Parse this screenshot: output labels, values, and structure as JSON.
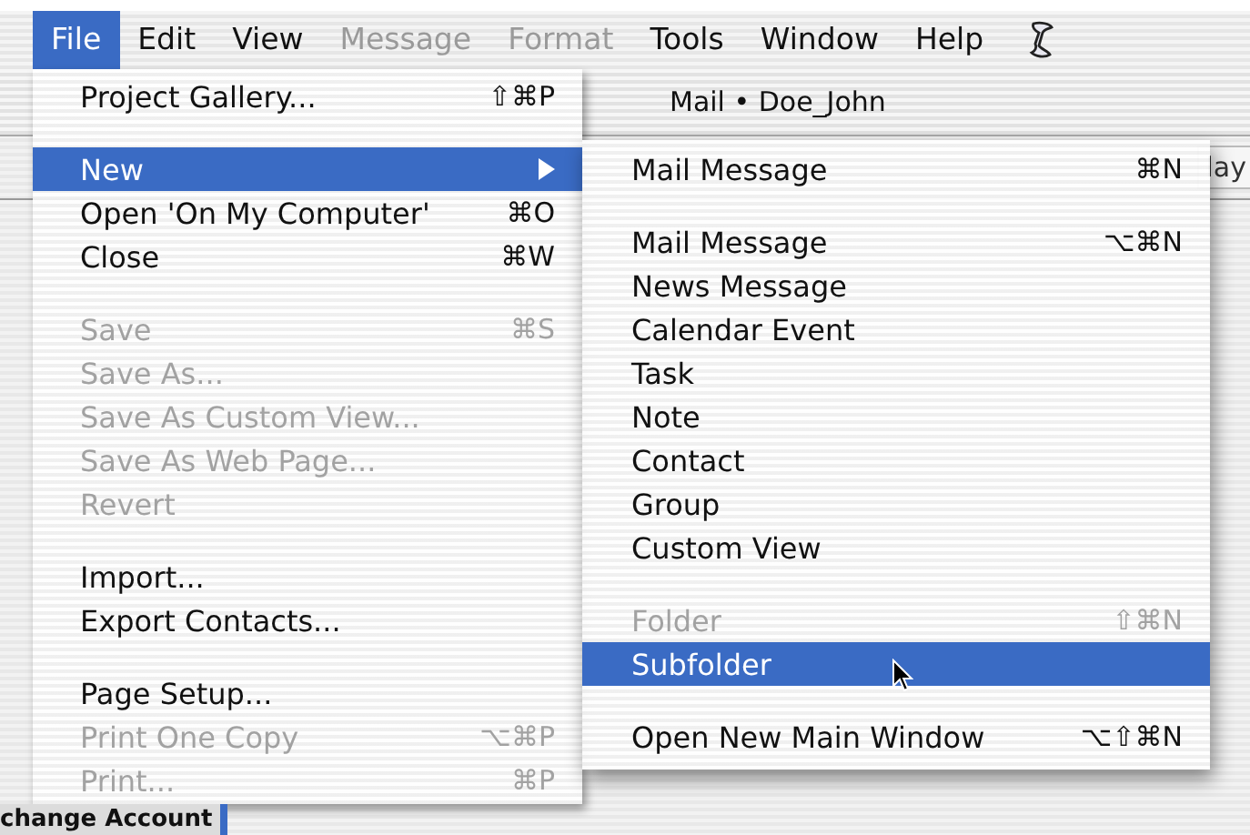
{
  "menubar": {
    "items": [
      {
        "label": "File",
        "selected": true,
        "disabled": false
      },
      {
        "label": "Edit",
        "selected": false,
        "disabled": false
      },
      {
        "label": "View",
        "selected": false,
        "disabled": false
      },
      {
        "label": "Message",
        "selected": false,
        "disabled": true
      },
      {
        "label": "Format",
        "selected": false,
        "disabled": true
      },
      {
        "label": "Tools",
        "selected": false,
        "disabled": false
      },
      {
        "label": "Window",
        "selected": false,
        "disabled": false
      },
      {
        "label": "Help",
        "selected": false,
        "disabled": false
      }
    ]
  },
  "background_window": {
    "title": "Mail • Doe_John",
    "toolbar_button": "lay",
    "sidebar_account": "change Account"
  },
  "file_menu": {
    "items": [
      {
        "kind": "item",
        "label": "Project Gallery...",
        "shortcut": "⇧⌘P",
        "disabled": false,
        "selected": false
      },
      {
        "kind": "separator"
      },
      {
        "kind": "submenu",
        "label": "New",
        "disabled": false,
        "selected": true
      },
      {
        "kind": "item",
        "label": "Open 'On My Computer'",
        "shortcut": "⌘O",
        "disabled": false,
        "selected": false
      },
      {
        "kind": "item",
        "label": "Close",
        "shortcut": "⌘W",
        "disabled": false,
        "selected": false
      },
      {
        "kind": "separator"
      },
      {
        "kind": "item",
        "label": "Save",
        "shortcut": "⌘S",
        "disabled": true,
        "selected": false
      },
      {
        "kind": "item",
        "label": "Save As...",
        "disabled": true,
        "selected": false
      },
      {
        "kind": "item",
        "label": "Save As Custom View...",
        "disabled": true,
        "selected": false
      },
      {
        "kind": "item",
        "label": "Save As Web Page...",
        "disabled": true,
        "selected": false
      },
      {
        "kind": "item",
        "label": "Revert",
        "disabled": true,
        "selected": false
      },
      {
        "kind": "separator"
      },
      {
        "kind": "item",
        "label": "Import...",
        "disabled": false,
        "selected": false
      },
      {
        "kind": "item",
        "label": "Export Contacts...",
        "disabled": false,
        "selected": false
      },
      {
        "kind": "separator"
      },
      {
        "kind": "item",
        "label": "Page Setup...",
        "disabled": false,
        "selected": false
      },
      {
        "kind": "item",
        "label": "Print One Copy",
        "shortcut": "⌥⌘P",
        "disabled": true,
        "selected": false
      },
      {
        "kind": "item",
        "label": "Print...",
        "shortcut": "⌘P",
        "disabled": true,
        "selected": false
      }
    ]
  },
  "new_submenu": {
    "items": [
      {
        "kind": "item",
        "label": "Mail Message",
        "shortcut": "⌘N",
        "disabled": false,
        "selected": false
      },
      {
        "kind": "separator"
      },
      {
        "kind": "item",
        "label": "Mail Message",
        "shortcut": "⌥⌘N",
        "disabled": false,
        "selected": false
      },
      {
        "kind": "item",
        "label": "News Message",
        "disabled": false,
        "selected": false
      },
      {
        "kind": "item",
        "label": "Calendar Event",
        "disabled": false,
        "selected": false
      },
      {
        "kind": "item",
        "label": "Task",
        "disabled": false,
        "selected": false
      },
      {
        "kind": "item",
        "label": "Note",
        "disabled": false,
        "selected": false
      },
      {
        "kind": "item",
        "label": "Contact",
        "disabled": false,
        "selected": false
      },
      {
        "kind": "item",
        "label": "Group",
        "disabled": false,
        "selected": false
      },
      {
        "kind": "item",
        "label": "Custom View",
        "disabled": false,
        "selected": false
      },
      {
        "kind": "separator"
      },
      {
        "kind": "item",
        "label": "Folder",
        "shortcut": "⇧⌘N",
        "disabled": true,
        "selected": false
      },
      {
        "kind": "item",
        "label": "Subfolder",
        "disabled": false,
        "selected": true
      },
      {
        "kind": "separator"
      },
      {
        "kind": "item",
        "label": "Open New Main Window",
        "shortcut": "⌥⇧⌘N",
        "disabled": false,
        "selected": false
      }
    ]
  }
}
